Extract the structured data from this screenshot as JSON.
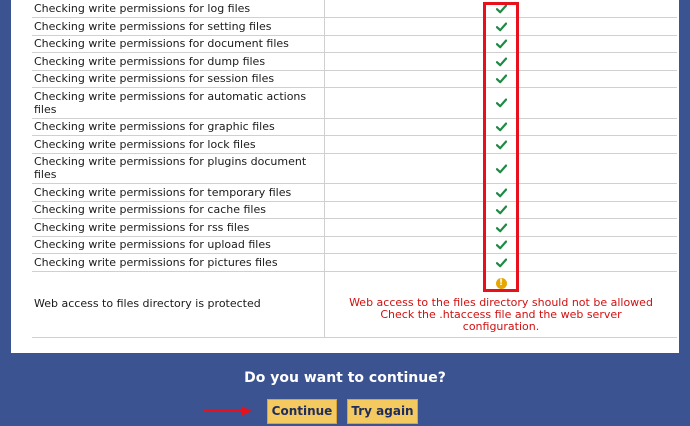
{
  "checks": [
    {
      "label": "Checking write permissions for log files",
      "status": "ok"
    },
    {
      "label": "Checking write permissions for setting files",
      "status": "ok"
    },
    {
      "label": "Checking write permissions for document files",
      "status": "ok"
    },
    {
      "label": "Checking write permissions for dump files",
      "status": "ok"
    },
    {
      "label": "Checking write permissions for session files",
      "status": "ok"
    },
    {
      "label": "Checking write permissions for automatic actions files",
      "status": "ok"
    },
    {
      "label": "Checking write permissions for graphic files",
      "status": "ok"
    },
    {
      "label": "Checking write permissions for lock files",
      "status": "ok"
    },
    {
      "label": "Checking write permissions for plugins document files",
      "status": "ok"
    },
    {
      "label": "Checking write permissions for temporary files",
      "status": "ok"
    },
    {
      "label": "Checking write permissions for cache files",
      "status": "ok"
    },
    {
      "label": "Checking write permissions for rss files",
      "status": "ok"
    },
    {
      "label": "Checking write permissions for upload files",
      "status": "ok"
    },
    {
      "label": "Checking write permissions for pictures files",
      "status": "ok"
    }
  ],
  "web_access": {
    "label": "Web access to files directory is protected",
    "status": "warning",
    "warning_icon": "!",
    "message_lines": [
      "Web access to the files directory should not be allowed",
      "Check the .htaccess file and the web server",
      "configuration."
    ]
  },
  "footer": {
    "question": "Do you want to continue?",
    "continue_label": "Continue",
    "try_again_label": "Try again"
  },
  "colors": {
    "background": "#3c5391",
    "ok": "#1e8a44",
    "warning": "#e6a700",
    "error_text": "#d01010",
    "highlight": "#e8101a",
    "button": "#f4c95f"
  }
}
